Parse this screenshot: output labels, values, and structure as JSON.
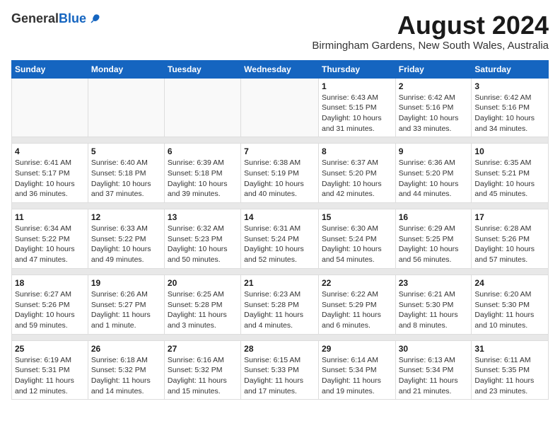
{
  "header": {
    "logo_general": "General",
    "logo_blue": "Blue",
    "main_title": "August 2024",
    "subtitle": "Birmingham Gardens, New South Wales, Australia"
  },
  "calendar": {
    "days_of_week": [
      "Sunday",
      "Monday",
      "Tuesday",
      "Wednesday",
      "Thursday",
      "Friday",
      "Saturday"
    ],
    "weeks": [
      [
        {
          "day": "",
          "info": ""
        },
        {
          "day": "",
          "info": ""
        },
        {
          "day": "",
          "info": ""
        },
        {
          "day": "",
          "info": ""
        },
        {
          "day": "1",
          "info": "Sunrise: 6:43 AM\nSunset: 5:15 PM\nDaylight: 10 hours\nand 31 minutes."
        },
        {
          "day": "2",
          "info": "Sunrise: 6:42 AM\nSunset: 5:16 PM\nDaylight: 10 hours\nand 33 minutes."
        },
        {
          "day": "3",
          "info": "Sunrise: 6:42 AM\nSunset: 5:16 PM\nDaylight: 10 hours\nand 34 minutes."
        }
      ],
      [
        {
          "day": "4",
          "info": "Sunrise: 6:41 AM\nSunset: 5:17 PM\nDaylight: 10 hours\nand 36 minutes."
        },
        {
          "day": "5",
          "info": "Sunrise: 6:40 AM\nSunset: 5:18 PM\nDaylight: 10 hours\nand 37 minutes."
        },
        {
          "day": "6",
          "info": "Sunrise: 6:39 AM\nSunset: 5:18 PM\nDaylight: 10 hours\nand 39 minutes."
        },
        {
          "day": "7",
          "info": "Sunrise: 6:38 AM\nSunset: 5:19 PM\nDaylight: 10 hours\nand 40 minutes."
        },
        {
          "day": "8",
          "info": "Sunrise: 6:37 AM\nSunset: 5:20 PM\nDaylight: 10 hours\nand 42 minutes."
        },
        {
          "day": "9",
          "info": "Sunrise: 6:36 AM\nSunset: 5:20 PM\nDaylight: 10 hours\nand 44 minutes."
        },
        {
          "day": "10",
          "info": "Sunrise: 6:35 AM\nSunset: 5:21 PM\nDaylight: 10 hours\nand 45 minutes."
        }
      ],
      [
        {
          "day": "11",
          "info": "Sunrise: 6:34 AM\nSunset: 5:22 PM\nDaylight: 10 hours\nand 47 minutes."
        },
        {
          "day": "12",
          "info": "Sunrise: 6:33 AM\nSunset: 5:22 PM\nDaylight: 10 hours\nand 49 minutes."
        },
        {
          "day": "13",
          "info": "Sunrise: 6:32 AM\nSunset: 5:23 PM\nDaylight: 10 hours\nand 50 minutes."
        },
        {
          "day": "14",
          "info": "Sunrise: 6:31 AM\nSunset: 5:24 PM\nDaylight: 10 hours\nand 52 minutes."
        },
        {
          "day": "15",
          "info": "Sunrise: 6:30 AM\nSunset: 5:24 PM\nDaylight: 10 hours\nand 54 minutes."
        },
        {
          "day": "16",
          "info": "Sunrise: 6:29 AM\nSunset: 5:25 PM\nDaylight: 10 hours\nand 56 minutes."
        },
        {
          "day": "17",
          "info": "Sunrise: 6:28 AM\nSunset: 5:26 PM\nDaylight: 10 hours\nand 57 minutes."
        }
      ],
      [
        {
          "day": "18",
          "info": "Sunrise: 6:27 AM\nSunset: 5:26 PM\nDaylight: 10 hours\nand 59 minutes."
        },
        {
          "day": "19",
          "info": "Sunrise: 6:26 AM\nSunset: 5:27 PM\nDaylight: 11 hours\nand 1 minute."
        },
        {
          "day": "20",
          "info": "Sunrise: 6:25 AM\nSunset: 5:28 PM\nDaylight: 11 hours\nand 3 minutes."
        },
        {
          "day": "21",
          "info": "Sunrise: 6:23 AM\nSunset: 5:28 PM\nDaylight: 11 hours\nand 4 minutes."
        },
        {
          "day": "22",
          "info": "Sunrise: 6:22 AM\nSunset: 5:29 PM\nDaylight: 11 hours\nand 6 minutes."
        },
        {
          "day": "23",
          "info": "Sunrise: 6:21 AM\nSunset: 5:30 PM\nDaylight: 11 hours\nand 8 minutes."
        },
        {
          "day": "24",
          "info": "Sunrise: 6:20 AM\nSunset: 5:30 PM\nDaylight: 11 hours\nand 10 minutes."
        }
      ],
      [
        {
          "day": "25",
          "info": "Sunrise: 6:19 AM\nSunset: 5:31 PM\nDaylight: 11 hours\nand 12 minutes."
        },
        {
          "day": "26",
          "info": "Sunrise: 6:18 AM\nSunset: 5:32 PM\nDaylight: 11 hours\nand 14 minutes."
        },
        {
          "day": "27",
          "info": "Sunrise: 6:16 AM\nSunset: 5:32 PM\nDaylight: 11 hours\nand 15 minutes."
        },
        {
          "day": "28",
          "info": "Sunrise: 6:15 AM\nSunset: 5:33 PM\nDaylight: 11 hours\nand 17 minutes."
        },
        {
          "day": "29",
          "info": "Sunrise: 6:14 AM\nSunset: 5:34 PM\nDaylight: 11 hours\nand 19 minutes."
        },
        {
          "day": "30",
          "info": "Sunrise: 6:13 AM\nSunset: 5:34 PM\nDaylight: 11 hours\nand 21 minutes."
        },
        {
          "day": "31",
          "info": "Sunrise: 6:11 AM\nSunset: 5:35 PM\nDaylight: 11 hours\nand 23 minutes."
        }
      ]
    ]
  }
}
